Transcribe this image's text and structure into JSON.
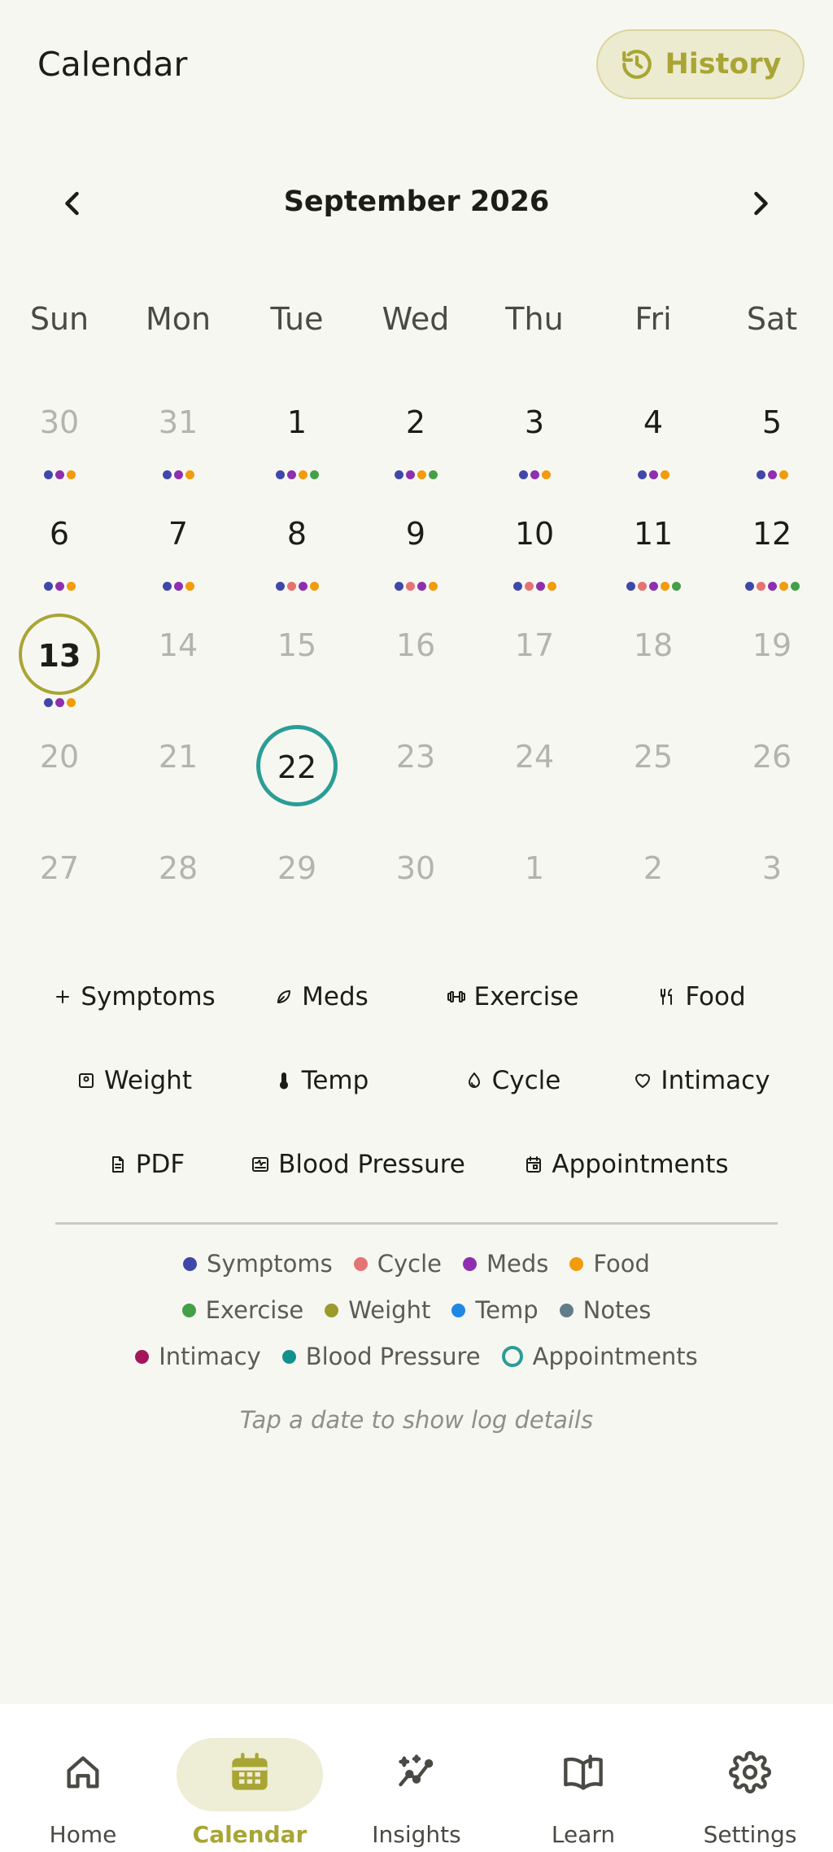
{
  "header": {
    "title": "Calendar",
    "history_label": "History"
  },
  "month_nav": {
    "label": "September 2026"
  },
  "weekdays": [
    "Sun",
    "Mon",
    "Tue",
    "Wed",
    "Thu",
    "Fri",
    "Sat"
  ],
  "colors": {
    "symptoms": "#3f48a8",
    "cycle": "#e57373",
    "meds": "#8e2fb0",
    "food": "#f29b0c",
    "exercise": "#43a047",
    "weight": "#9c9a2c",
    "temp": "#1e88e5",
    "notes": "#607d8b",
    "intimacy": "#a3175a",
    "blood_pressure": "#12908e",
    "appointments": "#2a9d96"
  },
  "calendar": {
    "weeks": [
      [
        {
          "day": "30",
          "current": false,
          "dots": [
            "symptoms",
            "meds",
            "food"
          ]
        },
        {
          "day": "31",
          "current": false,
          "dots": [
            "symptoms",
            "meds",
            "food"
          ]
        },
        {
          "day": "1",
          "current": true,
          "dots": [
            "symptoms",
            "meds",
            "food",
            "exercise"
          ]
        },
        {
          "day": "2",
          "current": true,
          "dots": [
            "symptoms",
            "meds",
            "food",
            "exercise"
          ]
        },
        {
          "day": "3",
          "current": true,
          "dots": [
            "symptoms",
            "meds",
            "food"
          ]
        },
        {
          "day": "4",
          "current": true,
          "dots": [
            "symptoms",
            "meds",
            "food"
          ]
        },
        {
          "day": "5",
          "current": true,
          "dots": [
            "symptoms",
            "meds",
            "food"
          ]
        }
      ],
      [
        {
          "day": "6",
          "current": true,
          "dots": [
            "symptoms",
            "meds",
            "food"
          ]
        },
        {
          "day": "7",
          "current": true,
          "dots": [
            "symptoms",
            "meds",
            "food"
          ]
        },
        {
          "day": "8",
          "current": true,
          "dots": [
            "symptoms",
            "cycle",
            "meds",
            "food"
          ]
        },
        {
          "day": "9",
          "current": true,
          "dots": [
            "symptoms",
            "cycle",
            "meds",
            "food"
          ]
        },
        {
          "day": "10",
          "current": true,
          "dots": [
            "symptoms",
            "cycle",
            "meds",
            "food"
          ]
        },
        {
          "day": "11",
          "current": true,
          "dots": [
            "symptoms",
            "cycle",
            "meds",
            "food",
            "exercise"
          ]
        },
        {
          "day": "12",
          "current": true,
          "dots": [
            "symptoms",
            "cycle",
            "meds",
            "food",
            "exercise"
          ]
        }
      ],
      [
        {
          "day": "13",
          "current": true,
          "today": true,
          "dots": [
            "symptoms",
            "meds",
            "food"
          ]
        },
        {
          "day": "14",
          "current": false,
          "dots": []
        },
        {
          "day": "15",
          "current": false,
          "dots": []
        },
        {
          "day": "16",
          "current": false,
          "dots": []
        },
        {
          "day": "17",
          "current": false,
          "dots": []
        },
        {
          "day": "18",
          "current": false,
          "dots": []
        },
        {
          "day": "19",
          "current": false,
          "dots": []
        }
      ],
      [
        {
          "day": "20",
          "current": false,
          "dots": []
        },
        {
          "day": "21",
          "current": false,
          "dots": []
        },
        {
          "day": "22",
          "current": true,
          "appointment": true,
          "dots": []
        },
        {
          "day": "23",
          "current": false,
          "dots": []
        },
        {
          "day": "24",
          "current": false,
          "dots": []
        },
        {
          "day": "25",
          "current": false,
          "dots": []
        },
        {
          "day": "26",
          "current": false,
          "dots": []
        }
      ],
      [
        {
          "day": "27",
          "current": false,
          "dots": []
        },
        {
          "day": "28",
          "current": false,
          "dots": []
        },
        {
          "day": "29",
          "current": false,
          "dots": []
        },
        {
          "day": "30",
          "current": false,
          "dots": []
        },
        {
          "day": "1",
          "current": false,
          "dots": []
        },
        {
          "day": "2",
          "current": false,
          "dots": []
        },
        {
          "day": "3",
          "current": false,
          "dots": []
        }
      ]
    ]
  },
  "quick_actions": [
    {
      "label": "Symptoms",
      "icon": "plus-icon"
    },
    {
      "label": "Meds",
      "icon": "leaf-icon"
    },
    {
      "label": "Exercise",
      "icon": "dumbbell-icon"
    },
    {
      "label": "Food",
      "icon": "utensils-icon"
    },
    {
      "label": "Weight",
      "icon": "scale-icon"
    },
    {
      "label": "Temp",
      "icon": "thermometer-icon"
    },
    {
      "label": "Cycle",
      "icon": "droplet-icon"
    },
    {
      "label": "Intimacy",
      "icon": "heart-icon"
    },
    {
      "label": "PDF",
      "icon": "document-icon"
    },
    {
      "label": "Blood Pressure",
      "icon": "pulse-monitor-icon"
    },
    {
      "label": "Appointments",
      "icon": "calendar-icon"
    }
  ],
  "legend": [
    {
      "label": "Symptoms",
      "key": "symptoms"
    },
    {
      "label": "Cycle",
      "key": "cycle"
    },
    {
      "label": "Meds",
      "key": "meds"
    },
    {
      "label": "Food",
      "key": "food"
    },
    {
      "label": "Exercise",
      "key": "exercise"
    },
    {
      "label": "Weight",
      "key": "weight"
    },
    {
      "label": "Temp",
      "key": "temp"
    },
    {
      "label": "Notes",
      "key": "notes"
    },
    {
      "label": "Intimacy",
      "key": "intimacy"
    },
    {
      "label": "Blood Pressure",
      "key": "blood_pressure"
    },
    {
      "label": "Appointments",
      "key": "appointments"
    }
  ],
  "hint": "Tap a date to show log details",
  "bottom_nav": [
    {
      "label": "Home",
      "icon": "home-icon",
      "active": false
    },
    {
      "label": "Calendar",
      "icon": "calendar-icon",
      "active": true
    },
    {
      "label": "Insights",
      "icon": "insights-icon",
      "active": false
    },
    {
      "label": "Learn",
      "icon": "book-icon",
      "active": false
    },
    {
      "label": "Settings",
      "icon": "gear-icon",
      "active": false
    }
  ]
}
